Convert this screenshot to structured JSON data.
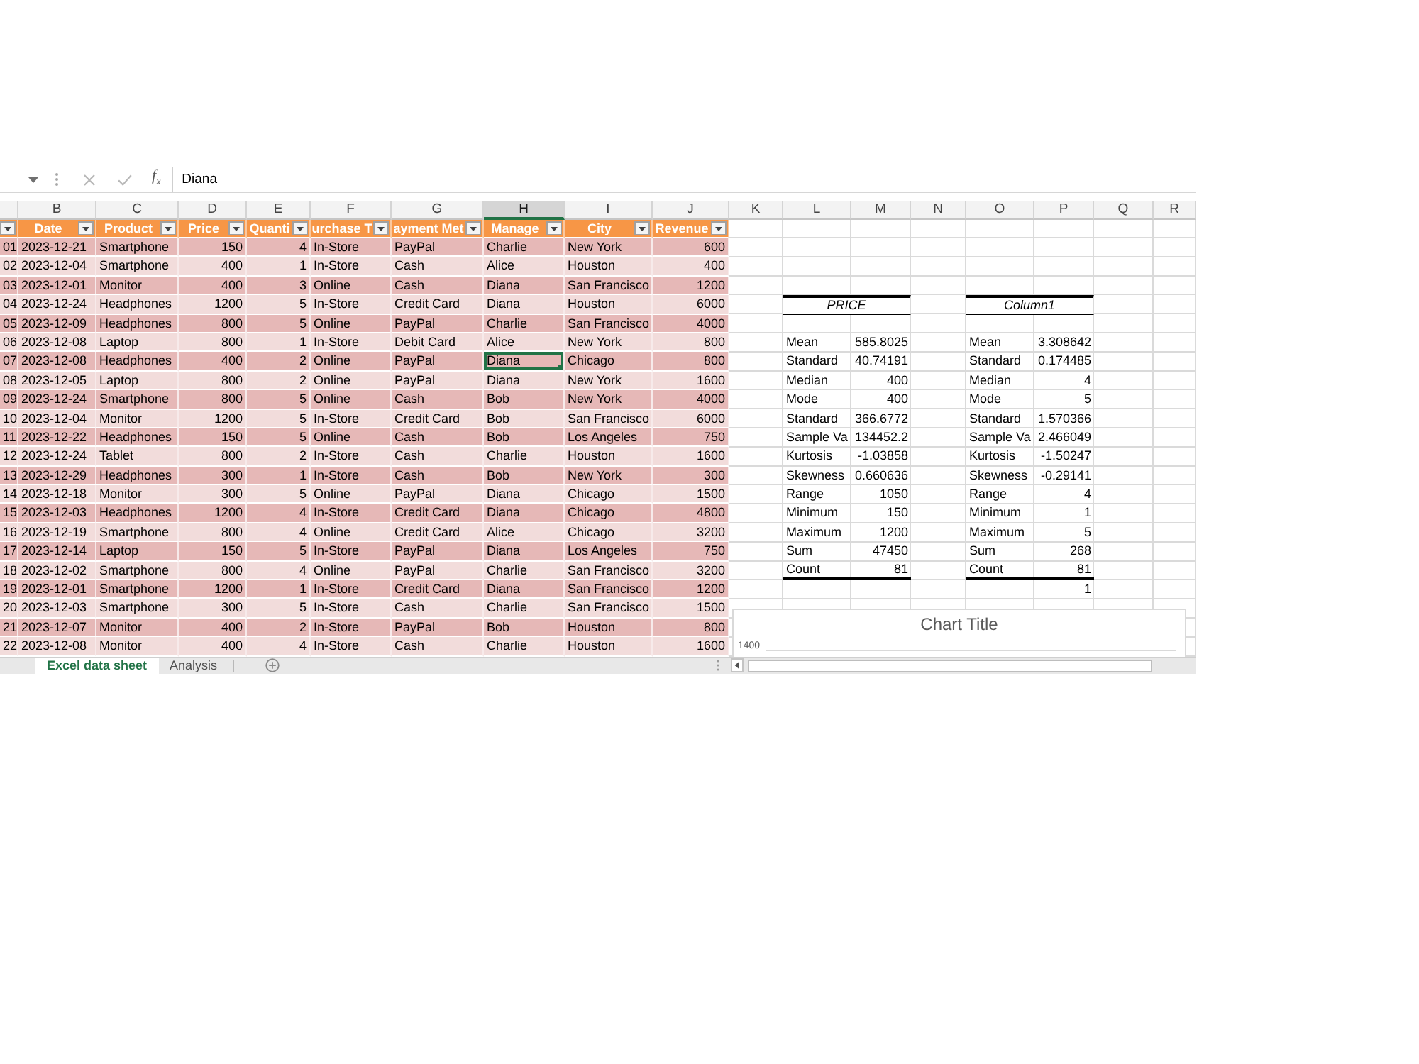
{
  "formula_bar": {
    "function_label": "f$_{x}$",
    "content": "Diana"
  },
  "columns": [
    {
      "selected": false
    },
    {
      "label": "B",
      "selected": false
    },
    {
      "label": "C",
      "selected": false
    },
    {
      "label": "D",
      "selected": false
    },
    {
      "label": "E",
      "selected": false
    },
    {
      "label": "F",
      "selected": false
    },
    {
      "label": "G",
      "selected": false
    },
    {
      "label": "H",
      "selected": true
    },
    {
      "label": "I",
      "selected": false
    },
    {
      "label": "J",
      "selected": false
    },
    {
      "label": "K",
      "selected": false
    },
    {
      "label": "L",
      "selected": false
    },
    {
      "label": "M",
      "selected": false
    },
    {
      "label": "N",
      "selected": false
    },
    {
      "label": "O",
      "selected": false
    },
    {
      "label": "P",
      "selected": false
    },
    {
      "label": "Q",
      "selected": false
    },
    {
      "label": "R",
      "selected": false
    }
  ],
  "table": {
    "header": [
      {
        "filter": true
      },
      {
        "label": "Date",
        "filter": true
      },
      {
        "label": "Product",
        "filter": true
      },
      {
        "label": "Price",
        "filter": true
      },
      {
        "label": "Quanti",
        "filter": true
      },
      {
        "label": "urchase T",
        "filter": true
      },
      {
        "label": "ayment Met",
        "filter": true
      },
      {
        "label": "Manage",
        "filter": true
      },
      {
        "label": "City",
        "filter": true
      },
      {
        "label": "Revenue",
        "filter": true
      }
    ],
    "rows": [
      {
        "selected": false,
        "cells": [
          "01",
          "2023-12-21",
          "Smartphone",
          "150",
          "4",
          "In-Store",
          "PayPal",
          "Charlie",
          "New York",
          "600"
        ]
      },
      {
        "selected": false,
        "cells": [
          "02",
          "2023-12-04",
          "Smartphone",
          "400",
          "1",
          "In-Store",
          "Cash",
          "Alice",
          "Houston",
          "400"
        ]
      },
      {
        "selected": false,
        "cells": [
          "03",
          "2023-12-01",
          "Monitor",
          "400",
          "3",
          "Online",
          "Cash",
          "Diana",
          "San Francisco",
          "1200"
        ]
      },
      {
        "selected": false,
        "cells": [
          "04",
          "2023-12-24",
          "Headphones",
          "1200",
          "5",
          "In-Store",
          "Credit Card",
          "Diana",
          "Houston",
          "6000"
        ]
      },
      {
        "selected": false,
        "cells": [
          "05",
          "2023-12-09",
          "Headphones",
          "800",
          "5",
          "Online",
          "PayPal",
          "Charlie",
          "San Francisco",
          "4000"
        ]
      },
      {
        "selected": false,
        "cells": [
          "06",
          "2023-12-08",
          "Laptop",
          "800",
          "1",
          "In-Store",
          "Debit Card",
          "Alice",
          "New York",
          "800"
        ]
      },
      {
        "selected": true,
        "cells": [
          "07",
          "2023-12-08",
          "Headphones",
          "400",
          "2",
          "Online",
          "PayPal",
          "Diana",
          "Chicago",
          "800"
        ]
      },
      {
        "selected": false,
        "cells": [
          "08",
          "2023-12-05",
          "Laptop",
          "800",
          "2",
          "Online",
          "PayPal",
          "Diana",
          "New York",
          "1600"
        ]
      },
      {
        "selected": false,
        "cells": [
          "09",
          "2023-12-24",
          "Smartphone",
          "800",
          "5",
          "Online",
          "Cash",
          "Bob",
          "New York",
          "4000"
        ]
      },
      {
        "selected": false,
        "cells": [
          "10",
          "2023-12-04",
          "Monitor",
          "1200",
          "5",
          "In-Store",
          "Credit Card",
          "Bob",
          "San Francisco",
          "6000"
        ]
      },
      {
        "selected": false,
        "cells": [
          "11",
          "2023-12-22",
          "Headphones",
          "150",
          "5",
          "Online",
          "Cash",
          "Bob",
          "Los Angeles",
          "750"
        ]
      },
      {
        "selected": false,
        "cells": [
          "12",
          "2023-12-24",
          "Tablet",
          "800",
          "2",
          "In-Store",
          "Cash",
          "Charlie",
          "Houston",
          "1600"
        ]
      },
      {
        "selected": false,
        "cells": [
          "13",
          "2023-12-29",
          "Headphones",
          "300",
          "1",
          "In-Store",
          "Cash",
          "Bob",
          "New York",
          "300"
        ]
      },
      {
        "selected": false,
        "cells": [
          "14",
          "2023-12-18",
          "Monitor",
          "300",
          "5",
          "Online",
          "PayPal",
          "Diana",
          "Chicago",
          "1500"
        ]
      },
      {
        "selected": false,
        "cells": [
          "15",
          "2023-12-03",
          "Headphones",
          "1200",
          "4",
          "In-Store",
          "Credit Card",
          "Diana",
          "Chicago",
          "4800"
        ]
      },
      {
        "selected": false,
        "cells": [
          "16",
          "2023-12-19",
          "Smartphone",
          "800",
          "4",
          "Online",
          "Credit Card",
          "Alice",
          "Chicago",
          "3200"
        ]
      },
      {
        "selected": false,
        "cells": [
          "17",
          "2023-12-14",
          "Laptop",
          "150",
          "5",
          "In-Store",
          "PayPal",
          "Diana",
          "Los Angeles",
          "750"
        ]
      },
      {
        "selected": false,
        "cells": [
          "18",
          "2023-12-02",
          "Smartphone",
          "800",
          "4",
          "Online",
          "PayPal",
          "Charlie",
          "San Francisco",
          "3200"
        ]
      },
      {
        "selected": false,
        "cells": [
          "19",
          "2023-12-01",
          "Smartphone",
          "1200",
          "1",
          "In-Store",
          "Credit Card",
          "Diana",
          "San Francisco",
          "1200"
        ]
      },
      {
        "selected": false,
        "cells": [
          "20",
          "2023-12-03",
          "Smartphone",
          "300",
          "5",
          "In-Store",
          "Cash",
          "Charlie",
          "San Francisco",
          "1500"
        ]
      },
      {
        "selected": false,
        "cells": [
          "21",
          "2023-12-07",
          "Monitor",
          "400",
          "2",
          "In-Store",
          "PayPal",
          "Bob",
          "Houston",
          "800"
        ]
      },
      {
        "selected": false,
        "cells": [
          "22",
          "2023-12-08",
          "Monitor",
          "400",
          "4",
          "In-Store",
          "Cash",
          "Charlie",
          "Houston",
          "1600"
        ]
      }
    ]
  },
  "stats": [
    {
      "heading": "PRICE",
      "rows": [
        {
          "label": "Mean",
          "value": "585.8025"
        },
        {
          "label": "Standard",
          "value": "40.74191"
        },
        {
          "label": "Median",
          "value": "400"
        },
        {
          "label": "Mode",
          "value": "400"
        },
        {
          "label": "Standard",
          "value": "366.6772"
        },
        {
          "label": "Sample Va",
          "value": "134452.2"
        },
        {
          "label": "Kurtosis",
          "value": "-1.03858"
        },
        {
          "label": "Skewness",
          "value": "0.660636"
        },
        {
          "label": "Range",
          "value": "1050"
        },
        {
          "label": "Minimum",
          "value": "150"
        },
        {
          "label": "Maximum",
          "value": "1200"
        },
        {
          "label": "Sum",
          "value": "47450"
        },
        {
          "label": "Count",
          "value": "81"
        }
      ]
    },
    {
      "heading": "Column1",
      "rows": [
        {
          "label": "Mean",
          "value": "3.308642"
        },
        {
          "label": "Standard",
          "value": "0.174485"
        },
        {
          "label": "Median",
          "value": "4"
        },
        {
          "label": "Mode",
          "value": "5"
        },
        {
          "label": "Standard",
          "value": "1.570366"
        },
        {
          "label": "Sample Va",
          "value": "2.466049"
        },
        {
          "label": "Kurtosis",
          "value": "-1.50247"
        },
        {
          "label": "Skewness",
          "value": "-0.29141"
        },
        {
          "label": "Range",
          "value": "4"
        },
        {
          "label": "Minimum",
          "value": "1"
        },
        {
          "label": "Maximum",
          "value": "5"
        },
        {
          "label": "Sum",
          "value": "268"
        },
        {
          "label": "Count",
          "value": "81"
        }
      ],
      "value_below": "1"
    }
  ],
  "chart": {
    "title": "Chart Title",
    "axis_label": "1400"
  },
  "sheet_tabs": [
    {
      "label": "Excel data sheet",
      "selected": true
    },
    {
      "label": "Analysis",
      "selected": false
    }
  ]
}
